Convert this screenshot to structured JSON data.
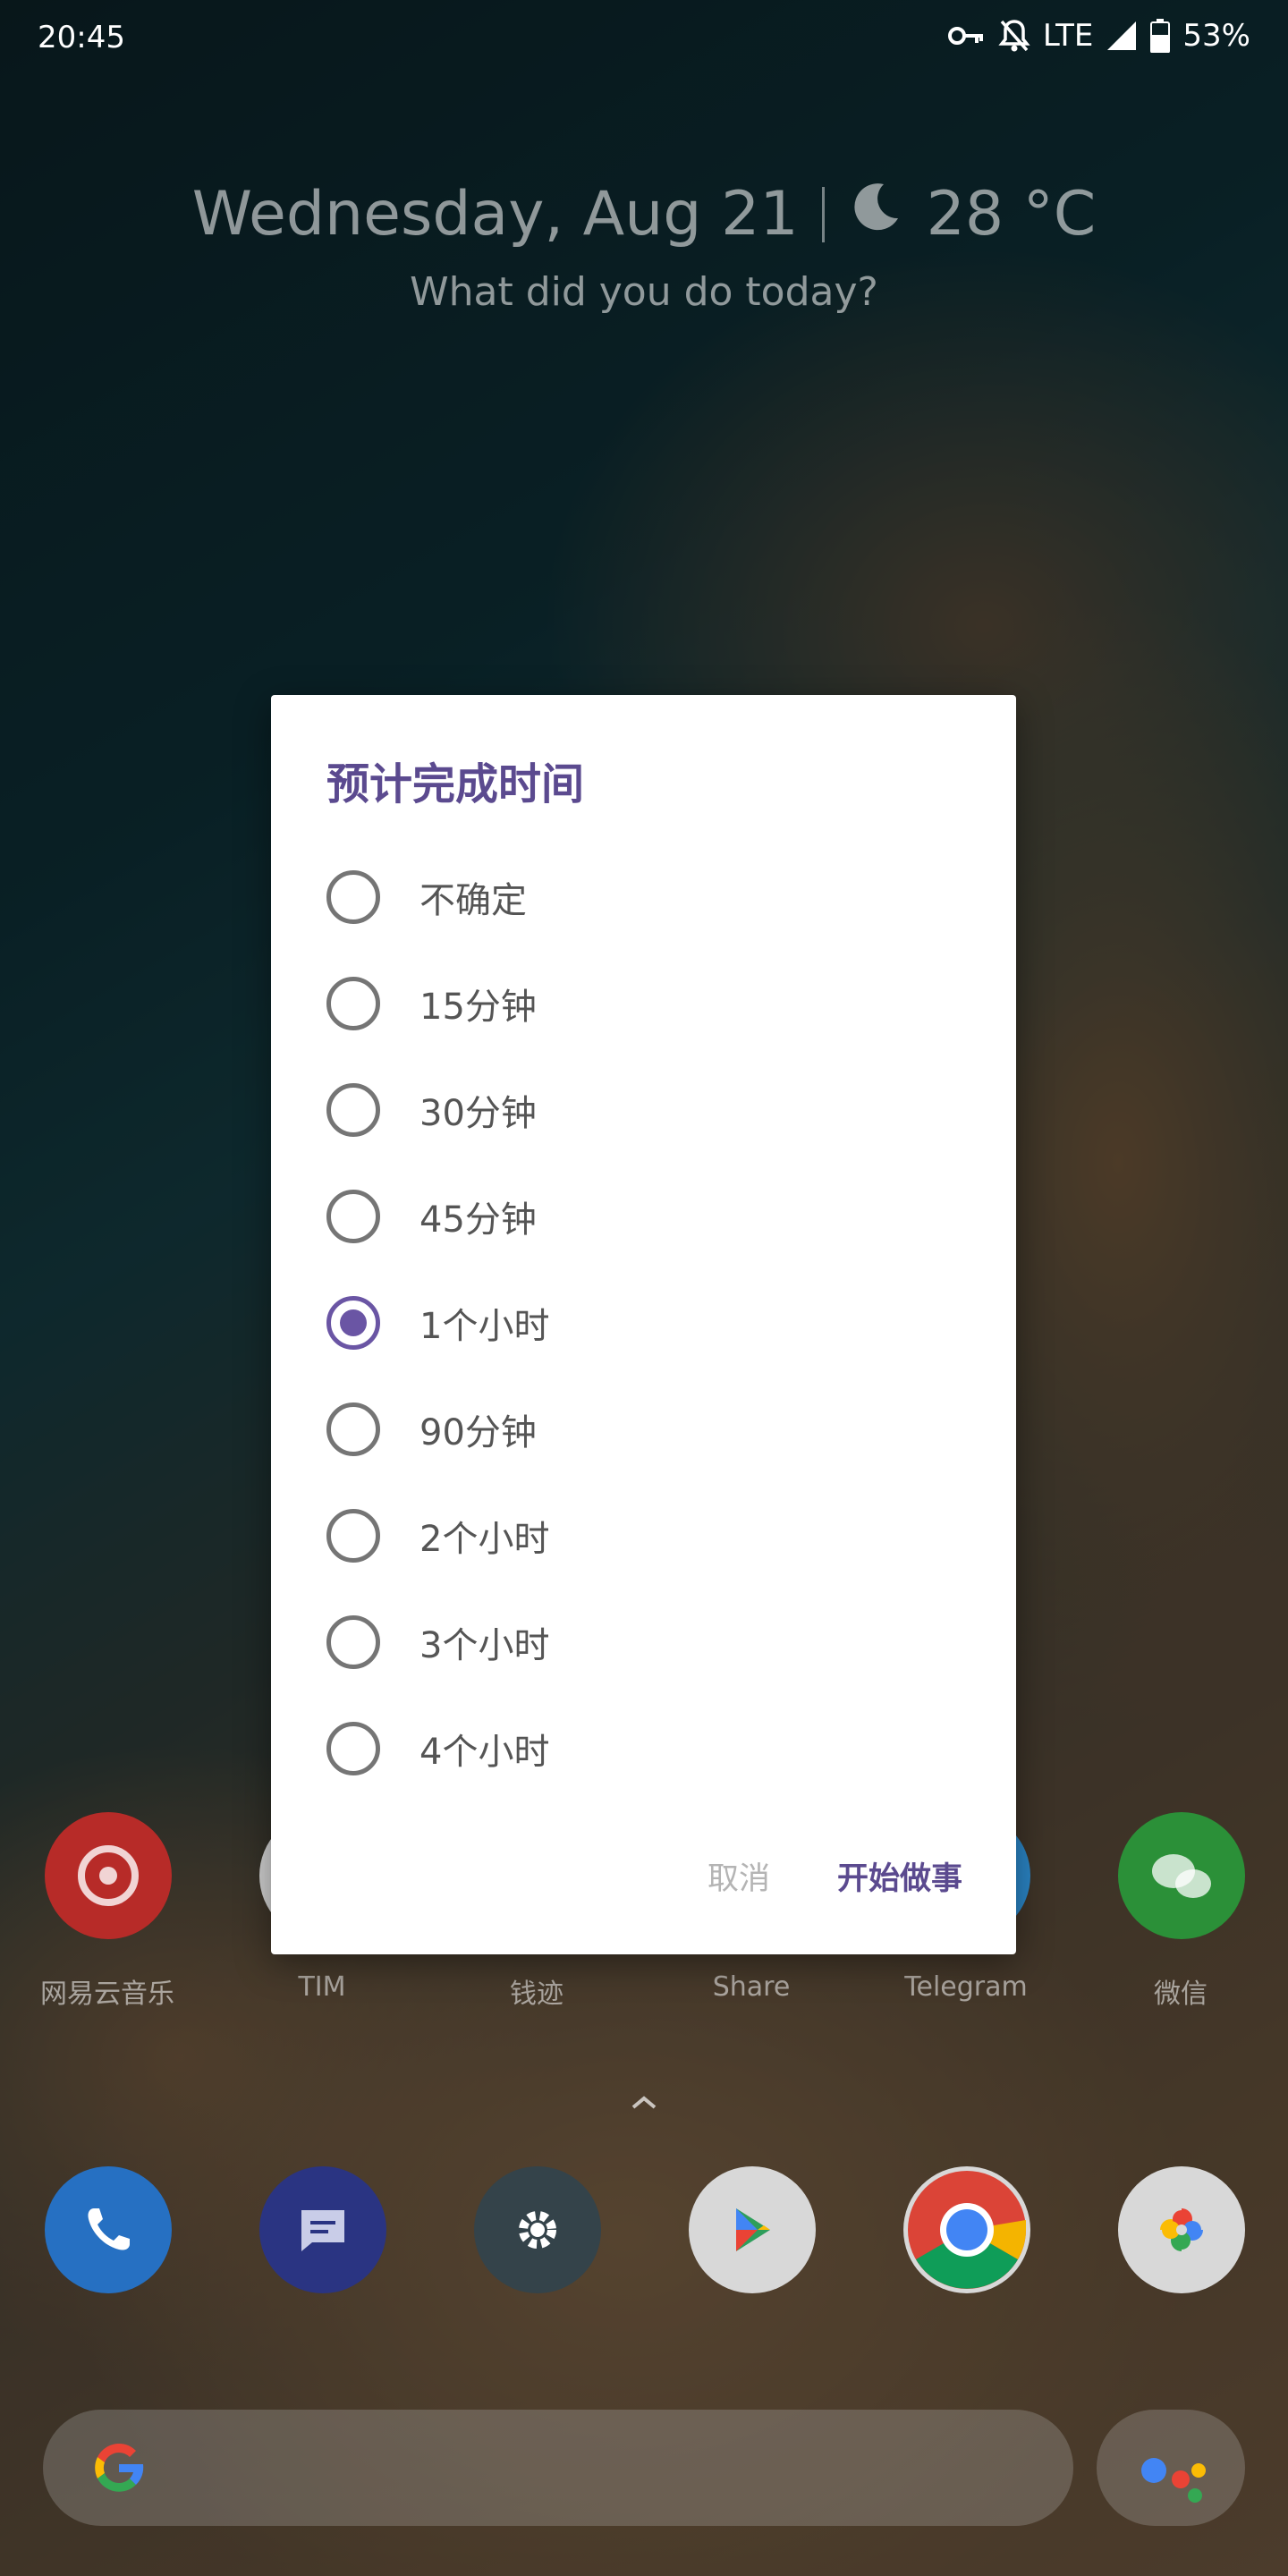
{
  "status_bar": {
    "time": "20:45",
    "network": "LTE",
    "battery": "53%",
    "icons": [
      "vpn-key-icon",
      "notifications-off-icon",
      "signal-icon",
      "battery-icon"
    ]
  },
  "glance": {
    "date": "Wednesday, Aug 21",
    "weather_icon": "moon-icon",
    "temperature": "28 °C",
    "subtitle": "What did you do today?"
  },
  "home_apps": [
    {
      "label": "网易云音乐",
      "icon": "netease-music-icon",
      "color": "#c8302c"
    },
    {
      "label": "TIM",
      "icon": "tim-icon",
      "color": "#e8e8e8"
    },
    {
      "label": "钱迹",
      "icon": "qianji-icon",
      "color": "#e8e8e8"
    },
    {
      "label": "Share",
      "icon": "share-icon",
      "color": "#e8e8e8"
    },
    {
      "label": "Telegram",
      "icon": "telegram-icon",
      "color": "#2f93d6"
    },
    {
      "label": "微信",
      "icon": "wechat-icon",
      "color": "#2fa53c"
    }
  ],
  "dialog": {
    "title": "预计完成时间",
    "options": [
      {
        "label": "不确定",
        "checked": false
      },
      {
        "label": "15分钟",
        "checked": false
      },
      {
        "label": "30分钟",
        "checked": false
      },
      {
        "label": "45分钟",
        "checked": false
      },
      {
        "label": "1个小时",
        "checked": true
      },
      {
        "label": "90分钟",
        "checked": false
      },
      {
        "label": "2个小时",
        "checked": false
      },
      {
        "label": "3个小时",
        "checked": false
      },
      {
        "label": "4个小时",
        "checked": false
      }
    ],
    "cancel_label": "取消",
    "confirm_label": "开始做事",
    "accent_color": "#5b4a8f"
  },
  "dock": [
    {
      "icon": "phone-icon",
      "color": "#2f7fd6"
    },
    {
      "icon": "messages-icon",
      "color": "#2e3a8c"
    },
    {
      "icon": "settings-icon",
      "color": "#3b4a52"
    },
    {
      "icon": "play-store-icon",
      "color": "#e8e8e8"
    },
    {
      "icon": "chrome-icon",
      "color": "#e8e8e8"
    },
    {
      "icon": "photos-icon",
      "color": "#e8e8e8"
    }
  ]
}
